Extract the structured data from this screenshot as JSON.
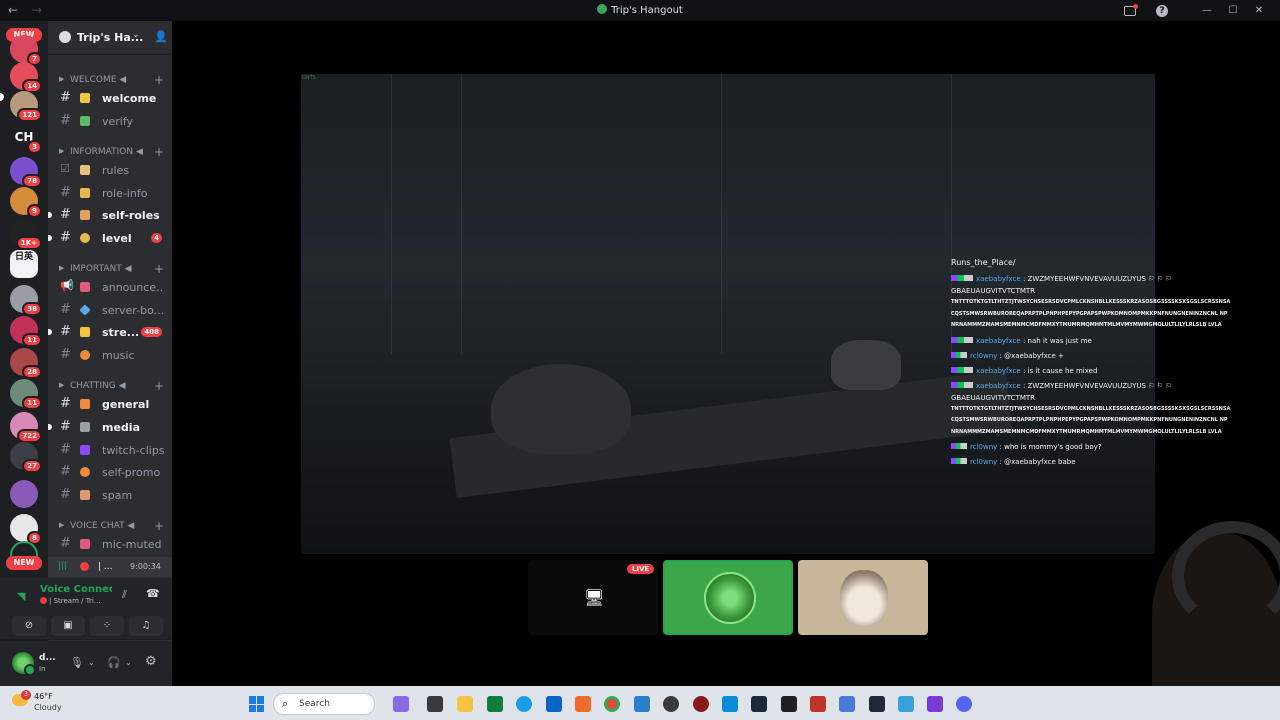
{
  "window": {
    "title": "Trip's Hangout"
  },
  "rail": {
    "new_label_top": "NEW",
    "new_label_bottom": "NEW",
    "servers": [
      {
        "badge": "7"
      },
      {
        "badge": "14"
      },
      {
        "badge": "121"
      },
      {
        "text": "CH",
        "badge": "3"
      },
      {
        "badge": "78"
      },
      {
        "badge": "9"
      },
      {
        "badge": "1K+"
      },
      {
        "text": "日英",
        "badge": ""
      },
      {
        "badge": "38"
      },
      {
        "badge": "11"
      },
      {
        "badge": "28"
      },
      {
        "badge": "11"
      },
      {
        "badge": "722"
      },
      {
        "badge": "27"
      },
      {
        "badge": ""
      },
      {
        "badge": "8"
      }
    ]
  },
  "guild": {
    "name": "Trip's Ha..."
  },
  "categories": {
    "welcome": "WELCOME ◀",
    "information": "INFORMATION ◀",
    "important": "IMPORTANT ◀",
    "chatting": "CHATTING ◀",
    "voice_chat": "VOICE CHAT ◀"
  },
  "channels": {
    "welcome": "welcome",
    "verify": "verify",
    "rules": "rules",
    "role_info": "role-info",
    "self_roles": "self-roles",
    "level": "level",
    "level_badge": "4",
    "announce": "announce...",
    "server_bo": "server-bo...",
    "stre": "stre...",
    "stre_badge": "408",
    "music": "music",
    "general": "general",
    "media": "media",
    "twitch_clips": "twitch-clips",
    "self_promo": "self-promo",
    "spam": "spam",
    "mic_muted": "mic-muted"
  },
  "voice_row": {
    "label": "| ...",
    "time": "9:00:34"
  },
  "voice_panel": {
    "title": "Voice Connecte",
    "subtitle": "| Stream / Tri..."
  },
  "user": {
    "name": "d...",
    "status": "In"
  },
  "stream": {
    "fps_label": "GNTS",
    "live_label": "LIVE"
  },
  "chat": {
    "title": "Runs_the_Place/",
    "messages": [
      {
        "user": "xaebabyfxce",
        "text": ": ZWZMYEEHWFVNVEVAVUUZUYUS ⚐ ⚐ ⚐ GBAEUAUGVITVTCTMTR",
        "long": "TNTTTOTKTGTLTHTZTJTWSYCHSESRSDVCPMLCKNSHBLLKESSSKRZASOSBGSSSSKSXSGSLSCRSSNSA CQSTSMWSRWBUROREQAPRPTPLPNPHPEPYPGPAPSPWPKOMNOMPMKKPNFNUNGNENINZNCNL NPNRNAMMMZMAMSMEMNMCMDFMMXYTMUMRMQMHMTMLMVMYMWMGMOLULTLILYLRLSLB LVLA"
      },
      {
        "user": "xaebabyfxce",
        "text": ": nah it was just me",
        "long": ""
      },
      {
        "user": "rcl0wny",
        "text": ": @xaebabyfxce +",
        "long": ""
      },
      {
        "user": "xaebabyfxce",
        "text": ": is it cause he mixed",
        "long": ""
      },
      {
        "user": "xaebabyfxce",
        "text": ": ZWZMYEEHWFVNVEVAVUUZUYUS ⚐ ⚐ ⚐ GBAEUAUGVITVTCTMTR",
        "long": "TNTTTOTKTGTLTHTZTJTWSYCHSESRSDVCPMLCKNSHBLLKESSSKRZASOSBGSSSSKSXSGSLSCRSSNSA CQSTSMWSRWBUROREQAPRPTPLPNPHPEPYPGPAPSPWPKOMNOMPMKKPNFNUNGNENINZNCNL NPNRNAMMMZMAMSMEMNMCMDFMMXYTMUMRMQMHMTMLMVMYMWMGMOLULTLILYLRLSLB LVLA"
      },
      {
        "user": "rcl0wny",
        "text": ": who is mommy's good boy?",
        "long": ""
      },
      {
        "user": "rcl0wny",
        "text": ": @xaebabyfxce babe",
        "long": ""
      }
    ]
  },
  "taskbar": {
    "temp": "46°F",
    "condition": "Cloudy",
    "weather_badge": "3",
    "search_placeholder": "Search"
  },
  "colors": {
    "accent_green": "#23a55a",
    "mention_red": "#f23f43",
    "sidebar_bg": "#2b2d31",
    "rail_bg": "#1e1f22"
  }
}
